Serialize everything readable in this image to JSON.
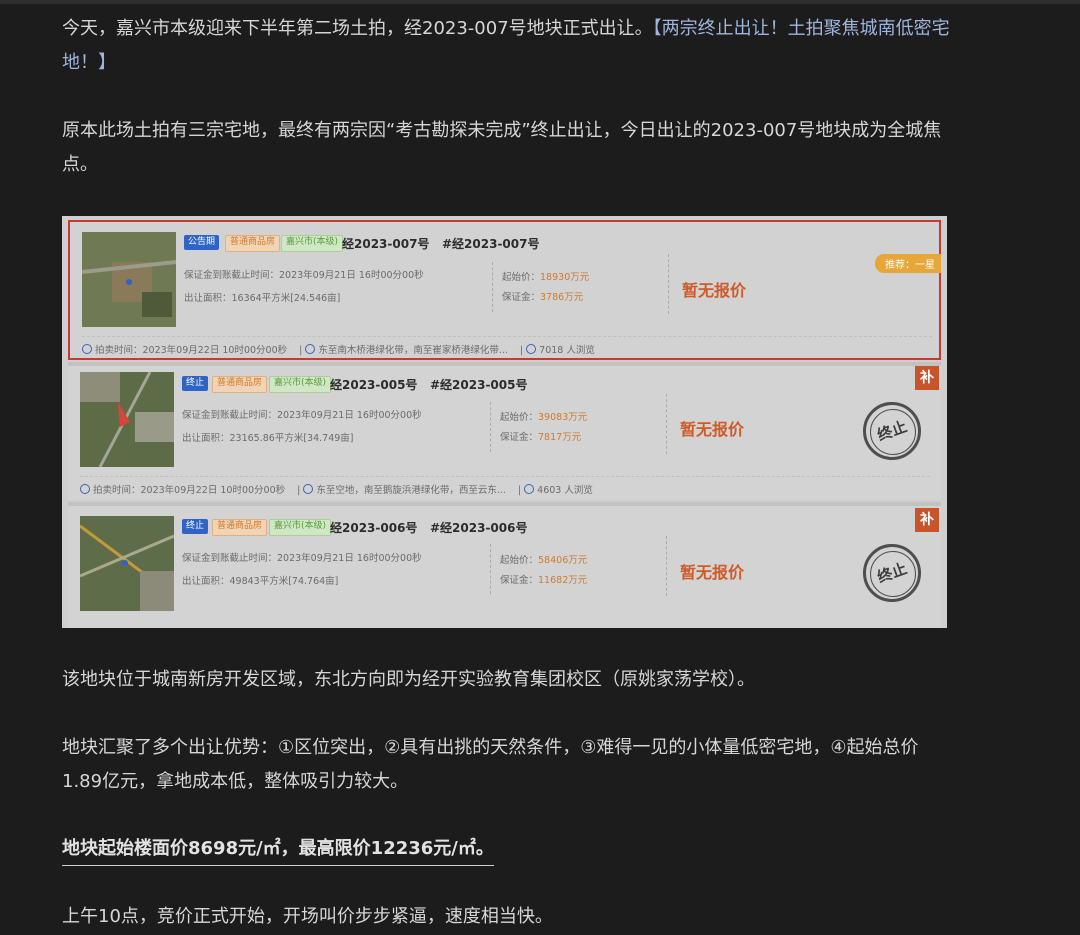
{
  "para1": {
    "text": "今天，嘉兴市本级迎来下半年第二场土拍，经2023-007号地块正式出让。",
    "link": "【两宗终止出让！土拍聚焦城南低密宅地！】"
  },
  "para2": "原本此场土拍有三宗宅地，最终有两宗因“考古勘探未完成”终止出让，今日出让的2023-007号地块成为全城焦点。",
  "listings": [
    {
      "status_tag": "公告期",
      "type_tag": "普通商品房",
      "area_tag": "嘉兴市(本级)",
      "code": "经2023-007号",
      "alt_code": "#经2023-007号",
      "deposit_deadline": "保证金到账截止时间：2023年09月21日 16时00分00秒",
      "area": "出让面积：16364平方米[24.546亩]",
      "start_price_label": "起始价：",
      "start_price": "18930万元",
      "deposit_label": "保证金：",
      "deposit": "3786万元",
      "quote": "暂无报价",
      "recommend": "推荐：一星",
      "auction_time": "拍卖时间：2023年09月22日 10时00分00秒",
      "location": "东至南木桥港绿化带，南至崔家桥港绿化带...",
      "views": "7018 人浏览"
    },
    {
      "status_tag": "终止",
      "type_tag": "普通商品房",
      "area_tag": "嘉兴市(本级)",
      "code": "经2023-005号",
      "alt_code": "#经2023-005号",
      "deposit_deadline": "保证金到账截止时间：2023年09月21日 16时00分00秒",
      "area": "出让面积：23165.86平方米[34.749亩]",
      "start_price_label": "起始价：",
      "start_price": "39083万元",
      "deposit_label": "保证金：",
      "deposit": "7817万元",
      "quote": "暂无报价",
      "badge": "补",
      "stamp": "终止",
      "auction_time": "拍卖时间：2023年09月22日 10时00分00秒",
      "location": "东至空地，南至鹅旋浜港绿化带，西至云东...",
      "views": "4603 人浏览"
    },
    {
      "status_tag": "终止",
      "type_tag": "普通商品房",
      "area_tag": "嘉兴市(本级)",
      "code": "经2023-006号",
      "alt_code": "#经2023-006号",
      "deposit_deadline": "保证金到账截止时间：2023年09月21日 16时00分00秒",
      "area": "出让面积：49843平方米[74.764亩]",
      "start_price_label": "起始价：",
      "start_price": "58406万元",
      "deposit_label": "保证金：",
      "deposit": "11682万元",
      "quote": "暂无报价",
      "badge": "补",
      "stamp": "终止"
    }
  ],
  "para3": "该地块位于城南新房开发区域，东北方向即为经开实验教育集团校区（原姚家荡学校）。",
  "para4": "地块汇聚了多个出让优势：①区位突出，②具有出挑的天然条件，③难得一见的小体量低密宅地，④起始总价1.89亿元，拿地成本低，整体吸引力较大。",
  "para5": "地块起始楼面价8698元/㎡，最高限价12236元/㎡。",
  "para6": "上午10点，竞价正式开始，开场叫价步步紧逼，速度相当快。"
}
